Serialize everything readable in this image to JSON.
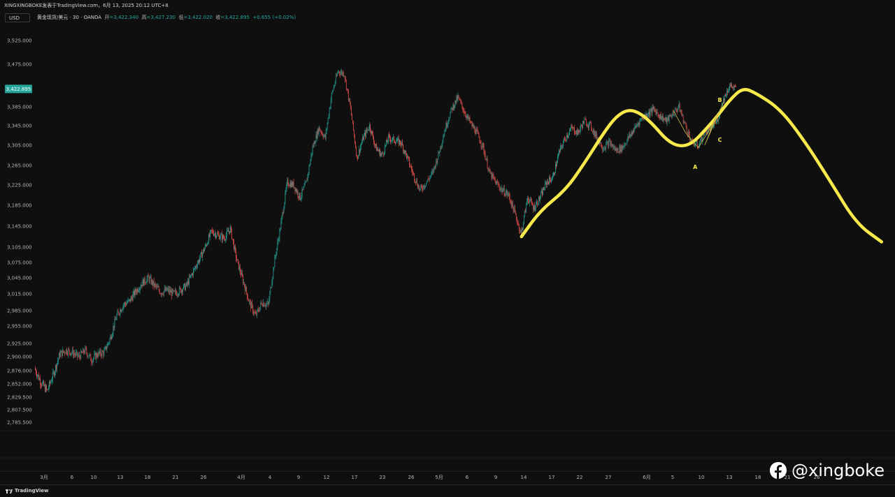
{
  "header": {
    "attribution": "XINGXINGBOKE发表于TradingView.com，6月 13, 2025 20:12 UTC+8",
    "currency": "USD"
  },
  "legend": {
    "symbol": "黄金现货/美元 · 30 · OANDA",
    "open_label": "开",
    "open": "=3,422.340",
    "high_label": "高",
    "high": "=3,427.230",
    "low_label": "低",
    "low": "=3,422.020",
    "close_label": "收",
    "close": "=3,422.895",
    "change": "+0.655 (+0.02%)"
  },
  "footer": {
    "brand": "TradingView"
  },
  "watermark": {
    "handle": "@xingboke"
  },
  "colors": {
    "up": "#26a69a",
    "down": "#ef5350",
    "highlight": "#f9e94a",
    "price_badge": "#26a69a"
  },
  "chart_data": {
    "type": "candlestick",
    "ylim": [
      2785.5,
      3525
    ],
    "y_ticks": [
      "3,525.000",
      "3,475.000",
      "3,385.000",
      "3,345.000",
      "3,305.000",
      "3,265.000",
      "3,225.000",
      "3,185.000",
      "3,145.000",
      "3,105.000",
      "3,075.000",
      "3,045.000",
      "3,015.000",
      "2,985.000",
      "2,955.000",
      "2,925.000",
      "2,900.000",
      "2,876.000",
      "2,852.000",
      "2,829.500",
      "2,807.500",
      "2,785.500"
    ],
    "x_ticks": [
      "3月",
      "6",
      "10",
      "13",
      "18",
      "21",
      "26",
      "4月",
      "4",
      "9",
      "12",
      "17",
      "23",
      "26",
      "5月",
      "6",
      "9",
      "14",
      "17",
      "22",
      "27",
      "6月",
      "5",
      "10",
      "13",
      "18",
      "21",
      "26"
    ],
    "current_price": "3,422.895",
    "price_path": [
      [
        0,
        2880
      ],
      [
        1,
        2855
      ],
      [
        2,
        2840
      ],
      [
        3,
        2870
      ],
      [
        4,
        2905
      ],
      [
        5,
        2912
      ],
      [
        6,
        2908
      ],
      [
        7,
        2900
      ],
      [
        8,
        2912
      ],
      [
        9,
        2895
      ],
      [
        10,
        2905
      ],
      [
        11,
        2908
      ],
      [
        12,
        2935
      ],
      [
        13,
        2975
      ],
      [
        14,
        2995
      ],
      [
        15,
        3002
      ],
      [
        16,
        3020
      ],
      [
        17,
        3035
      ],
      [
        18,
        3045
      ],
      [
        19,
        3030
      ],
      [
        20,
        3018
      ],
      [
        21,
        3022
      ],
      [
        22,
        3015
      ],
      [
        23,
        3022
      ],
      [
        24,
        3030
      ],
      [
        25,
        3055
      ],
      [
        26,
        3080
      ],
      [
        27,
        3105
      ],
      [
        28,
        3135
      ],
      [
        29,
        3128
      ],
      [
        30,
        3122
      ],
      [
        31,
        3140
      ],
      [
        32,
        3080
      ],
      [
        33,
        3040
      ],
      [
        34,
        3000
      ],
      [
        35,
        2975
      ],
      [
        36,
        3000
      ],
      [
        37,
        2995
      ],
      [
        38,
        3080
      ],
      [
        39,
        3150
      ],
      [
        40,
        3230
      ],
      [
        41,
        3225
      ],
      [
        42,
        3200
      ],
      [
        43,
        3230
      ],
      [
        44,
        3300
      ],
      [
        45,
        3340
      ],
      [
        46,
        3320
      ],
      [
        47,
        3410
      ],
      [
        48,
        3460
      ],
      [
        49,
        3455
      ],
      [
        50,
        3380
      ],
      [
        51,
        3280
      ],
      [
        52,
        3320
      ],
      [
        53,
        3345
      ],
      [
        54,
        3300
      ],
      [
        55,
        3285
      ],
      [
        56,
        3320
      ],
      [
        57,
        3315
      ],
      [
        58,
        3310
      ],
      [
        59,
        3280
      ],
      [
        60,
        3245
      ],
      [
        61,
        3215
      ],
      [
        62,
        3230
      ],
      [
        63,
        3250
      ],
      [
        64,
        3290
      ],
      [
        65,
        3340
      ],
      [
        66,
        3380
      ],
      [
        67,
        3405
      ],
      [
        68,
        3375
      ],
      [
        69,
        3350
      ],
      [
        70,
        3330
      ],
      [
        71,
        3300
      ],
      [
        72,
        3250
      ],
      [
        73,
        3230
      ],
      [
        74,
        3215
      ],
      [
        75,
        3205
      ],
      [
        76,
        3170
      ],
      [
        77,
        3130
      ],
      [
        78,
        3200
      ],
      [
        79,
        3180
      ],
      [
        80,
        3200
      ],
      [
        81,
        3230
      ],
      [
        82,
        3240
      ],
      [
        83,
        3290
      ],
      [
        84,
        3320
      ],
      [
        85,
        3340
      ],
      [
        86,
        3330
      ],
      [
        87,
        3355
      ],
      [
        88,
        3345
      ],
      [
        89,
        3320
      ],
      [
        90,
        3300
      ],
      [
        91,
        3310
      ],
      [
        92,
        3295
      ],
      [
        93,
        3300
      ],
      [
        94,
        3320
      ],
      [
        95,
        3340
      ],
      [
        96,
        3360
      ],
      [
        97,
        3370
      ],
      [
        98,
        3380
      ],
      [
        99,
        3365
      ],
      [
        100,
        3355
      ],
      [
        101,
        3370
      ],
      [
        102,
        3385
      ],
      [
        103,
        3345
      ],
      [
        104,
        3310
      ],
      [
        105,
        3305
      ],
      [
        106,
        3330
      ],
      [
        107,
        3340
      ],
      [
        108,
        3355
      ],
      [
        109,
        3400
      ],
      [
        110,
        3430
      ],
      [
        111,
        3422.9
      ]
    ],
    "annotations": [
      "A",
      "B",
      "C"
    ],
    "forecast_path": [
      [
        77,
        3125
      ],
      [
        80,
        3175
      ],
      [
        84,
        3215
      ],
      [
        87,
        3270
      ],
      [
        90,
        3330
      ],
      [
        92,
        3365
      ],
      [
        94,
        3380
      ],
      [
        96,
        3370
      ],
      [
        98,
        3345
      ],
      [
        100,
        3315
      ],
      [
        102,
        3302
      ],
      [
        104,
        3308
      ],
      [
        106,
        3335
      ],
      [
        108,
        3365
      ],
      [
        110,
        3400
      ],
      [
        112,
        3425
      ],
      [
        114,
        3415
      ],
      [
        118,
        3380
      ],
      [
        122,
        3310
      ],
      [
        126,
        3230
      ],
      [
        130,
        3150
      ],
      [
        134,
        3115
      ]
    ]
  }
}
